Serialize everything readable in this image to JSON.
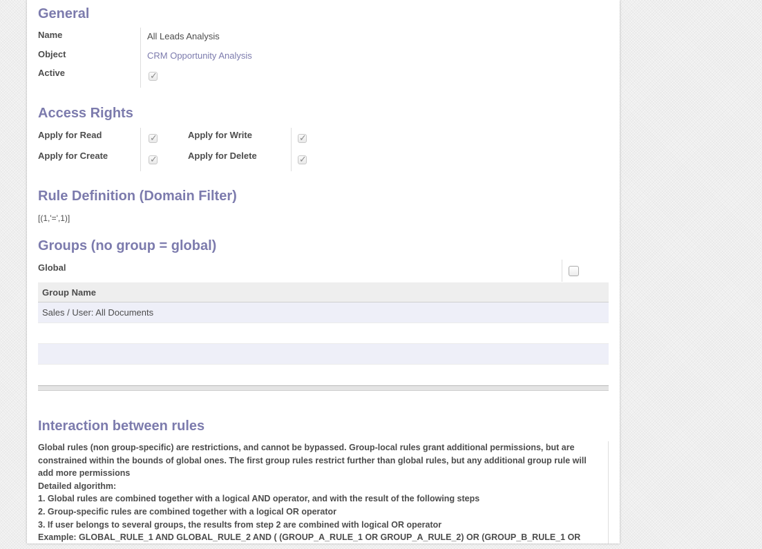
{
  "general": {
    "heading": "General",
    "name_label": "Name",
    "name_value": "All Leads Analysis",
    "object_label": "Object",
    "object_value": "CRM Opportunity Analysis",
    "active_label": "Active",
    "active_checked": true
  },
  "access": {
    "heading": "Access Rights",
    "read_label": "Apply for Read",
    "write_label": "Apply for Write",
    "create_label": "Apply for Create",
    "delete_label": "Apply for Delete",
    "read": true,
    "write": true,
    "create": true,
    "delete": true
  },
  "rule": {
    "heading": "Rule Definition (Domain Filter)",
    "domain": "[(1,'=',1)]"
  },
  "groups": {
    "heading": "Groups (no group = global)",
    "global_label": "Global",
    "global_checked": false,
    "column_header": "Group Name",
    "rows": [
      "Sales / User: All Documents"
    ]
  },
  "interaction": {
    "heading": "Interaction between rules",
    "lines": [
      "Global rules (non group-specific) are restrictions, and cannot be bypassed. Group-local rules grant additional permissions, but are constrained within the bounds of global ones. The first group rules restrict further than global rules, but any additional group rule will add more permissions",
      "Detailed algorithm:",
      "1. Global rules are combined together with a logical AND operator, and with the result of the following steps",
      "2. Group-specific rules are combined together with a logical OR operator",
      "3. If user belongs to several groups, the results from step 2 are combined with logical OR operator",
      "Example: GLOBAL_RULE_1 AND GLOBAL_RULE_2 AND ( (GROUP_A_RULE_1 OR GROUP_A_RULE_2) OR (GROUP_B_RULE_1 OR"
    ]
  },
  "colors": {
    "heading": "#7c7bad",
    "text": "#4c4c4c",
    "row_alt": "#eeeff8",
    "header_bg": "#eeeeee"
  }
}
